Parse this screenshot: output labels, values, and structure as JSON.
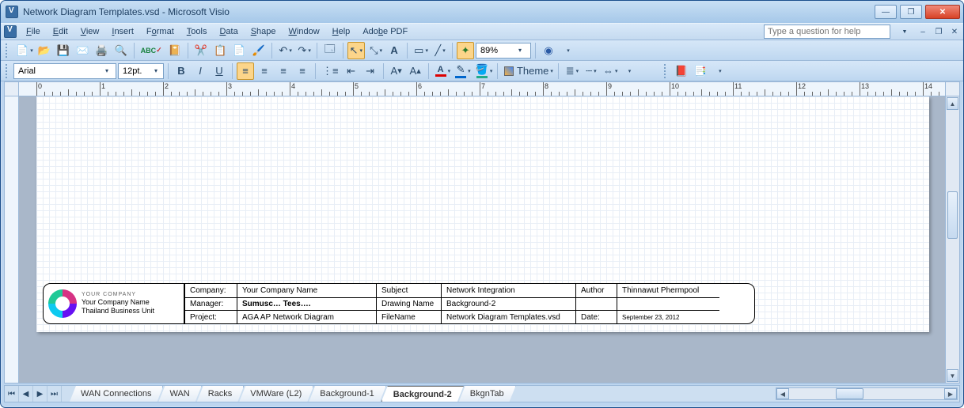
{
  "titlebar": {
    "title": "Network Diagram Templates.vsd - Microsoft Visio"
  },
  "menus": [
    "File",
    "Edit",
    "View",
    "Insert",
    "Format",
    "Tools",
    "Data",
    "Shape",
    "Window",
    "Help",
    "Adobe PDF"
  ],
  "help_placeholder": "Type a question for help",
  "toolbar": {
    "zoom_value": "89%"
  },
  "format": {
    "font": "Arial",
    "size": "12pt."
  },
  "theme_label": "Theme",
  "ruler": {
    "start": 0,
    "end": 14
  },
  "logo": {
    "brand": "YOUR COMPANY",
    "line1": "Your Company Name",
    "line2": "Thailand Business Unit"
  },
  "table": {
    "r1": {
      "company_l": "Company:",
      "company": "Your Company Name",
      "subject_l": "Subject",
      "subject": "Network Integration",
      "author_l": "Author",
      "author": "Thinnawut Phermpool"
    },
    "r2": {
      "manager_l": "Manager:",
      "manager": "Sumusc… Tees….",
      "drawing_l": "Drawing Name",
      "drawing": "Background-2",
      "blank_l": "",
      "blank": ""
    },
    "r3": {
      "project_l": "Project:",
      "project": "AGA AP Network Diagram",
      "file_l": "FileName",
      "file": "Network Diagram Templates.vsd",
      "date_l": "Date:",
      "date": "September 23, 2012"
    }
  },
  "tabs": [
    "WAN Connections",
    "WAN",
    "Racks",
    "VMWare (L2)",
    "Background-1",
    "Background-2",
    "BkgnTab"
  ],
  "active_tab": "Background-2"
}
